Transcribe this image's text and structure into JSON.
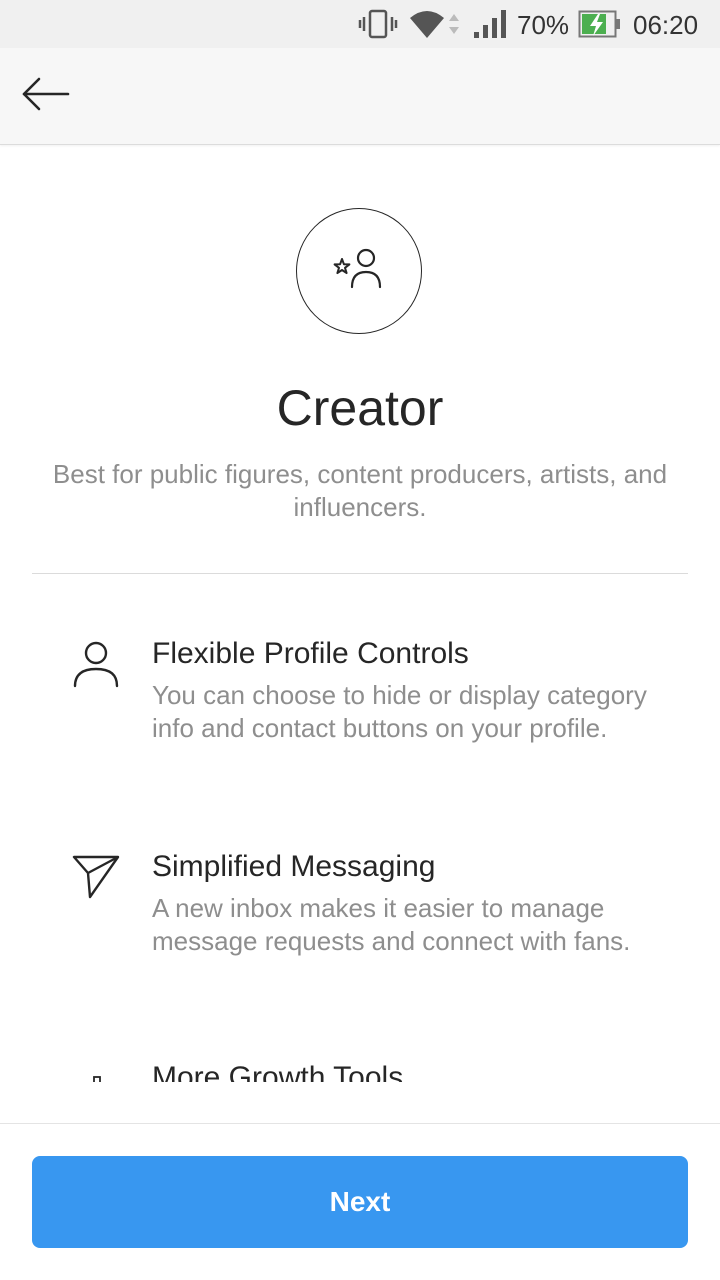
{
  "status_bar": {
    "battery_percent": "70%",
    "time": "06:20",
    "icons": [
      "vibrate-icon",
      "wifi-icon",
      "signal-icon",
      "battery-charging-icon"
    ]
  },
  "app_bar": {
    "back_icon": "arrow-left-icon"
  },
  "hero": {
    "icon": "creator-star-person-icon",
    "title": "Creator",
    "subtitle": "Best for public figures, content producers, artists, and influencers."
  },
  "features": [
    {
      "icon": "person-icon",
      "title": "Flexible Profile Controls",
      "description": "You can choose to hide or display category info and contact buttons on your profile."
    },
    {
      "icon": "paper-plane-icon",
      "title": "Simplified Messaging",
      "description": "A new inbox makes it easier to manage message requests and connect with fans."
    },
    {
      "icon": "bar-chart-icon",
      "title": "More Growth Tools",
      "description": ""
    }
  ],
  "footer": {
    "next_label": "Next"
  },
  "colors": {
    "accent": "#3897f0",
    "text_primary": "#262626",
    "text_secondary": "#8e8e8e",
    "battery": "#4caf50"
  }
}
